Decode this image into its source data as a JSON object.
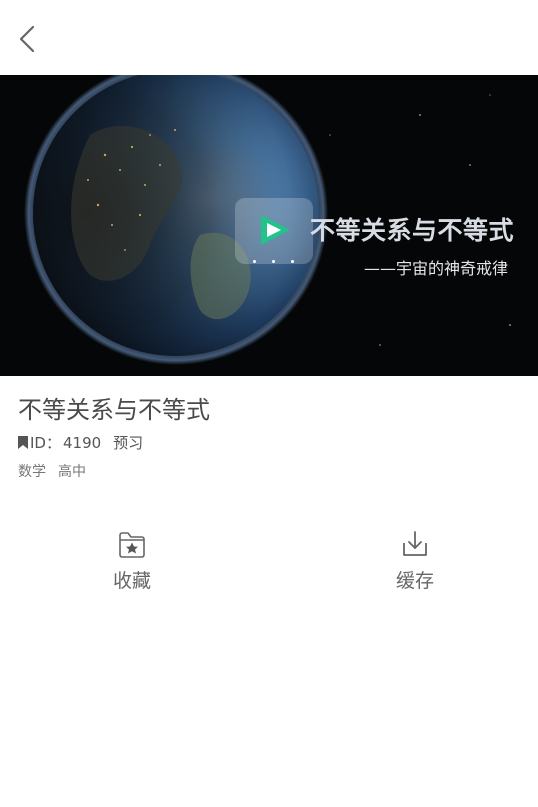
{
  "header": {
    "back_icon": "chevron-left-icon"
  },
  "video": {
    "title": "不等关系与不等式",
    "subtitle": "——宇宙的神奇戒律",
    "play_icon": "play-logo-icon",
    "colors": {
      "accent": "#20c48a",
      "background": "#050608"
    }
  },
  "resource": {
    "title": "不等关系与不等式",
    "bookmark_icon": "bookmark-icon",
    "id_label": "ID：",
    "id_value": "4190",
    "type_tag": "预习",
    "subject": "数学",
    "grade": "高中"
  },
  "actions": [
    {
      "label": "收藏",
      "icon": "favorite-folder-icon"
    },
    {
      "label": "缓存",
      "icon": "download-tray-icon"
    }
  ]
}
